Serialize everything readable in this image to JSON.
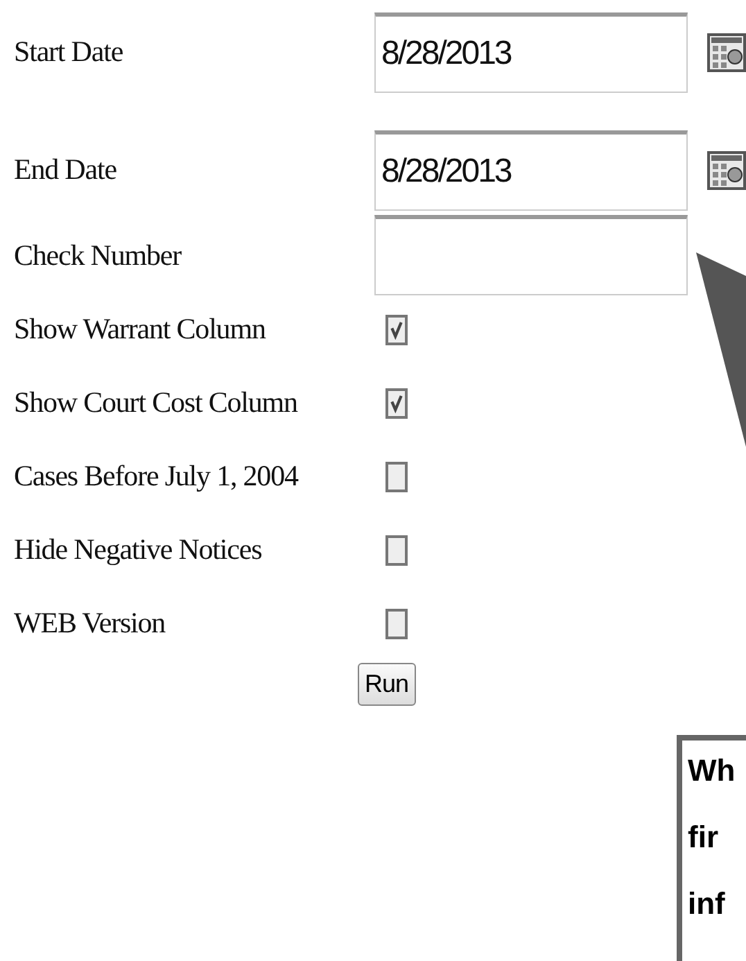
{
  "form": {
    "rows": [
      {
        "kind": "date",
        "label": "Start Date",
        "value": "8/28/2013"
      },
      {
        "kind": "date",
        "label": "End Date",
        "value": "8/28/2013"
      },
      {
        "kind": "text",
        "label": "Check Number",
        "value": ""
      },
      {
        "kind": "checkbox",
        "label": "Show Warrant Column",
        "checked": true
      },
      {
        "kind": "checkbox",
        "label": "Show Court Cost Column",
        "checked": true
      },
      {
        "kind": "checkbox",
        "label": "Cases Before July 1, 2004",
        "checked": false
      },
      {
        "kind": "checkbox",
        "label": "Hide Negative Notices",
        "checked": false
      },
      {
        "kind": "checkbox",
        "label": "WEB Version",
        "checked": false
      }
    ],
    "run_button": "Run"
  },
  "callout": {
    "lines": [
      "Wh",
      "fir",
      "inf"
    ]
  }
}
